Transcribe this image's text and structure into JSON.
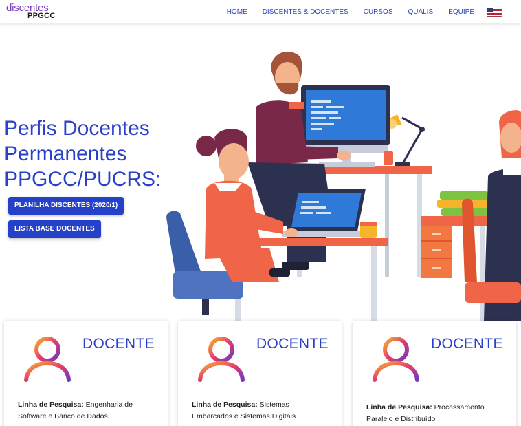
{
  "navbar": {
    "brand_top": "discentes",
    "brand_bottom": "PPGCC",
    "links": [
      "HOME",
      "DISCENTES & DOCENTES",
      "CURSOS",
      "QUALIS",
      "EQUIPE"
    ],
    "language_flag_icon": "us-flag-icon"
  },
  "hero": {
    "title": "Perfis Docentes\nPermanentes\nPPGCC/PUCRS:",
    "buttons": [
      "PLANILHA DISCENTES (2020/1)",
      "LISTA BASE DOCENTES"
    ],
    "illustration_icon": "people-at-computers-illustration"
  },
  "cards": [
    {
      "title": "DOCENTE",
      "research_label": "Linha de Pesquisa:",
      "research_value": "Engenharia de Software e Banco de Dados"
    },
    {
      "title": "DOCENTE",
      "research_label": "Linha de Pesquisa:",
      "research_value": "Sistemas Embarcados e Sistemas Digitais"
    },
    {
      "title": "DOCENTE",
      "research_label": "Linha de Pesquisa:",
      "research_value": "Processamento Paralelo e Distribuído"
    }
  ],
  "colors": {
    "primary": "#2a40c9",
    "button": "#2541c8",
    "brand": "#7a3ec2"
  }
}
